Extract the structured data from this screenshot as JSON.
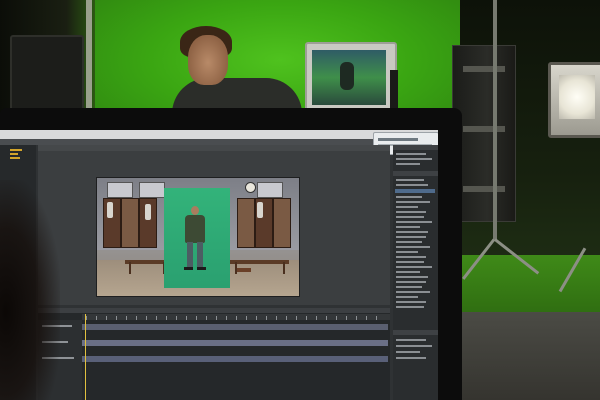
{
  "scene": {
    "description_colors": {
      "green_screen": "#3aa512",
      "comp_green": "#2aa070",
      "ui_bg": "#2f3234",
      "accent_playhead": "#e0c040"
    },
    "viewer": {
      "zoom_level": "",
      "comp_name": ""
    }
  }
}
